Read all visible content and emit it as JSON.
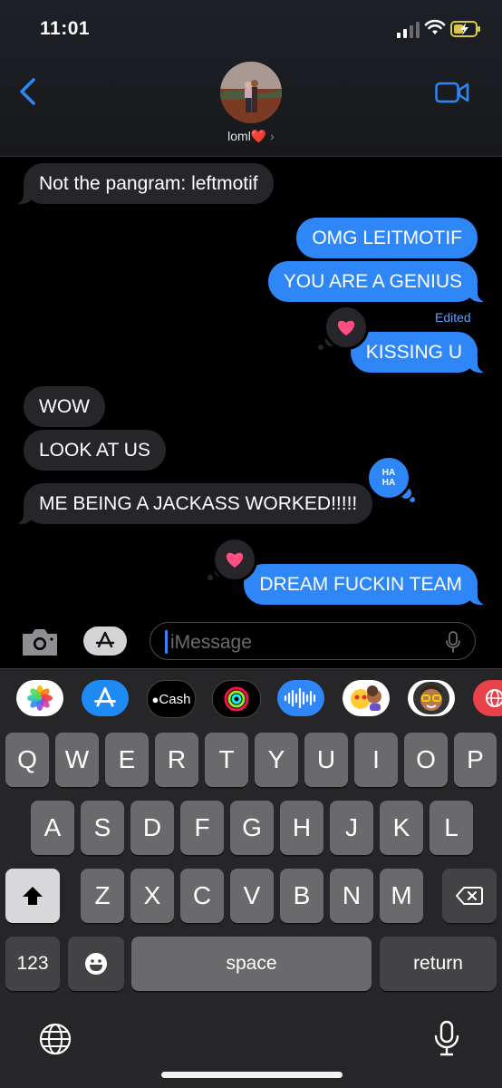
{
  "status_bar": {
    "time": "11:01"
  },
  "header": {
    "contact_name": "loml",
    "contact_emoji": "❤️"
  },
  "messages": [
    {
      "text": "Not the pangram: leftmotif",
      "direction": "incoming"
    },
    {
      "text": "OMG LEITMOTIF",
      "direction": "outgoing"
    },
    {
      "text": "YOU ARE A GENIUS",
      "direction": "outgoing",
      "edited_label": "Edited"
    },
    {
      "text": "KISSING U",
      "direction": "outgoing",
      "tapback": "heart"
    },
    {
      "text": "WOW",
      "direction": "incoming"
    },
    {
      "text": "LOOK AT US",
      "direction": "incoming"
    },
    {
      "text": "ME BEING A JACKASS WORKED!!!!!",
      "direction": "incoming",
      "tapback": "haha"
    },
    {
      "text": "DREAM FUCKIN TEAM",
      "direction": "outgoing",
      "tapback": "heart"
    }
  ],
  "tapback_haha_text": "HA HA",
  "composer": {
    "placeholder": "iMessage"
  },
  "app_drawer": [
    {
      "name": "photos-app-icon"
    },
    {
      "name": "app-store-icon"
    },
    {
      "name": "apple-cash-icon",
      "label": "Cash"
    },
    {
      "name": "fitness-activity-icon"
    },
    {
      "name": "audio-message-icon"
    },
    {
      "name": "memoji-stickers-icon"
    },
    {
      "name": "memoji-icon"
    },
    {
      "name": "web-search-icon"
    }
  ],
  "keyboard": {
    "row1": [
      "Q",
      "W",
      "E",
      "R",
      "T",
      "Y",
      "U",
      "I",
      "O",
      "P"
    ],
    "row2": [
      "A",
      "S",
      "D",
      "F",
      "G",
      "H",
      "J",
      "K",
      "L"
    ],
    "row3": [
      "Z",
      "X",
      "C",
      "V",
      "B",
      "N",
      "M"
    ],
    "numbers_label": "123",
    "space_label": "space",
    "return_label": "return"
  },
  "colors": {
    "outgoing_bubble": "#2f86f6",
    "incoming_bubble": "#26262a",
    "heart": "#ff4f7e"
  }
}
